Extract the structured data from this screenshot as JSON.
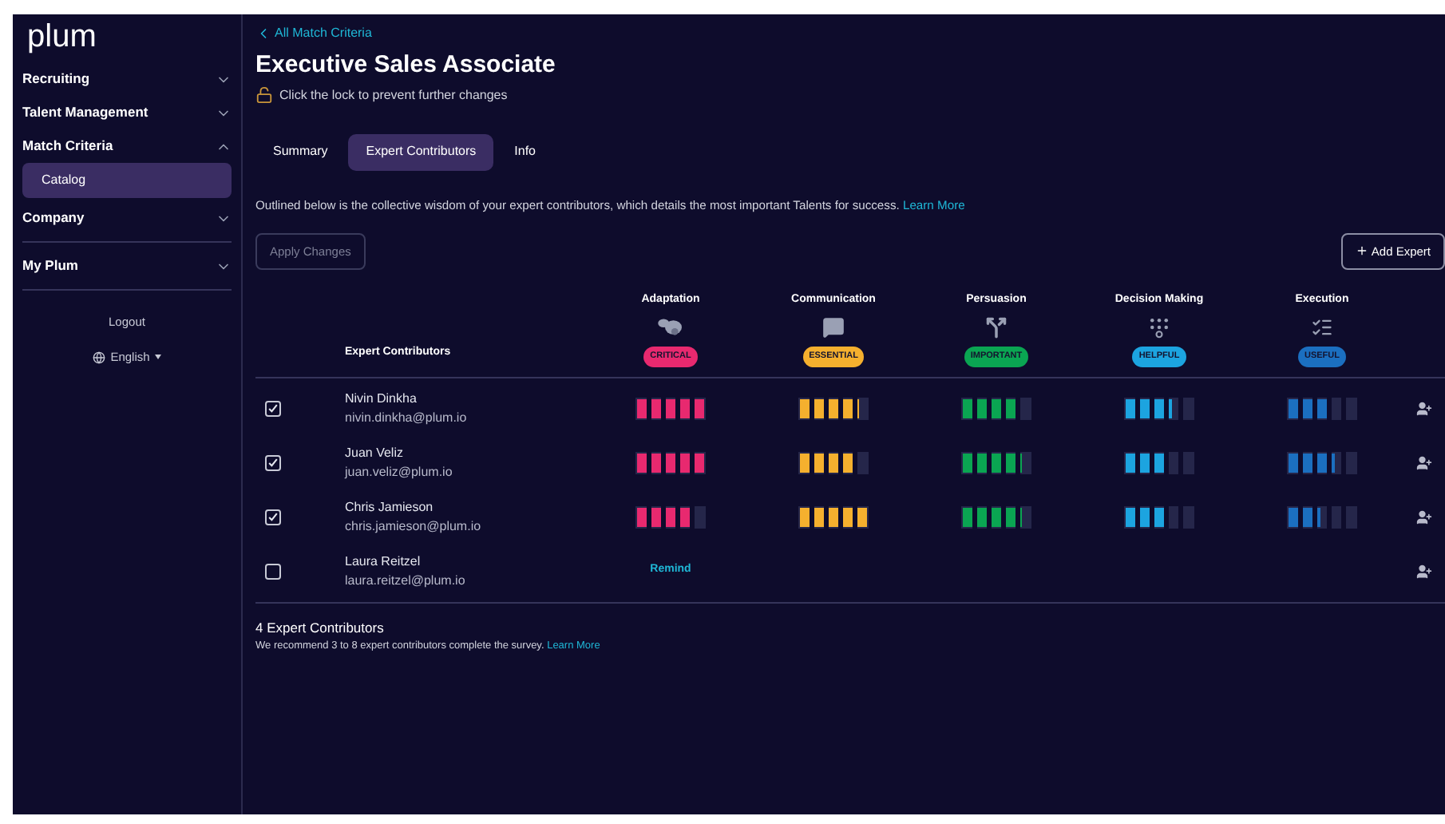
{
  "sidebar": {
    "logo": "plum",
    "sections": [
      {
        "items": [
          {
            "label": "Recruiting",
            "expanded": false
          },
          {
            "label": "Talent Management",
            "expanded": false
          },
          {
            "label": "Match Criteria",
            "expanded": true,
            "children": [
              {
                "label": "Catalog",
                "selected": true
              }
            ]
          },
          {
            "label": "Company",
            "expanded": false
          }
        ]
      },
      {
        "items": [
          {
            "label": "My Plum",
            "expanded": false
          }
        ]
      }
    ],
    "logout": "Logout",
    "language": "English"
  },
  "header": {
    "back_link": "All Match Criteria",
    "title": "Executive Sales Associate",
    "lock_hint": "Click the lock to prevent further changes",
    "locked": false
  },
  "tabs": [
    {
      "label": "Summary",
      "selected": false
    },
    {
      "label": "Expert Contributors",
      "selected": true
    },
    {
      "label": "Info",
      "selected": false
    }
  ],
  "description": {
    "text": "Outlined below is the collective wisdom of your expert contributors, which details the most important Talents for success.",
    "link": "Learn More"
  },
  "apply_button": {
    "label": "Apply Changes",
    "disabled": true
  },
  "add_button": {
    "label": "Add Expert"
  },
  "table": {
    "header": "Expert Contributors",
    "talents": [
      {
        "name": "Adaptation",
        "importance": "CRITICAL",
        "color": "#e8296f"
      },
      {
        "name": "Communication",
        "importance": "ESSENTIAL",
        "color": "#f5b02e"
      },
      {
        "name": "Persuasion",
        "importance": "IMPORTANT",
        "color": "#0aa552"
      },
      {
        "name": "Decision Making",
        "importance": "HELPFUL",
        "color": "#1ca4e0"
      },
      {
        "name": "Execution",
        "importance": "USEFUL",
        "color": "#1b6fc0"
      }
    ],
    "rows": [
      {
        "kind": "rated",
        "checked": true,
        "name": "Nivin Dinkha",
        "email": "nivin.dinkha@plum.io",
        "ratings": [
          {
            "level": 1
          },
          {
            "level": 0.88
          },
          {
            "level": 0.8
          },
          {
            "level": 0.68
          },
          {
            "level": 0.6
          }
        ]
      },
      {
        "kind": "rated",
        "checked": true,
        "name": "Juan Veliz",
        "email": "juan.veliz@plum.io",
        "ratings": [
          {
            "level": 1
          },
          {
            "level": 0.8
          },
          {
            "level": 0.88
          },
          {
            "level": 0.6
          },
          {
            "level": 0.68
          }
        ]
      },
      {
        "kind": "rated",
        "checked": true,
        "name": "Chris Jamieson",
        "email": "chris.jamieson@plum.io",
        "ratings": [
          {
            "level": 0.8
          },
          {
            "level": 1
          },
          {
            "level": 0.88
          },
          {
            "level": 0.6
          },
          {
            "level": 0.48
          }
        ]
      },
      {
        "kind": "pending",
        "checked": false,
        "name": "Laura Reitzel",
        "email": "laura.reitzel@plum.io",
        "action": "Remind"
      }
    ]
  },
  "footer": {
    "count": "4 Expert Contributors",
    "note": "We recommend 3 to 8 expert contributors complete the survey.",
    "link": "Learn More"
  }
}
